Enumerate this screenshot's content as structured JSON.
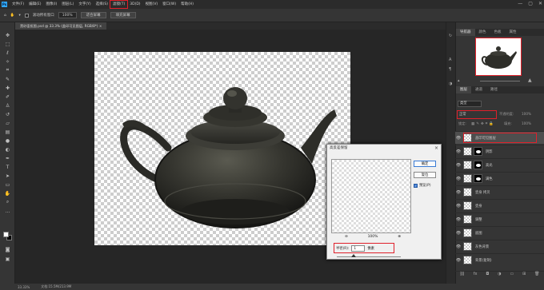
{
  "menubar": {
    "logo": "Ps",
    "items": [
      "文件(F)",
      "编辑(E)",
      "图像(I)",
      "图层(L)",
      "文字(Y)",
      "选择(S)",
      "滤镜(T)",
      "3D(D)",
      "视图(V)",
      "窗口(W)",
      "帮助(H)"
    ],
    "highlighted_index": 6,
    "window_controls": [
      "—",
      "▢",
      "✕"
    ]
  },
  "options": {
    "scroll_all_windows": "滚动所有窗口",
    "zoom": "100%",
    "fit_screen": "适合屏幕",
    "fill_screen": "填充屏幕"
  },
  "document": {
    "tab": "黑砂壶抠图.psd @ 33.3% (盖印可见图层, RGB/8*) ×"
  },
  "status": {
    "zoom": "33.33%",
    "doc": "文档:15.5M/213.9M"
  },
  "dialog": {
    "title": "高反差保留",
    "close": "×",
    "ok": "确定",
    "reset": "复位",
    "preview_label": "预览(P)",
    "zoom_out": "⊖",
    "zoom_level": "100%",
    "zoom_in": "⊕",
    "radius_label": "半径(R):",
    "radius_value": "1",
    "radius_unit": "像素"
  },
  "navigator": {
    "tabs": [
      "导航器",
      "颜色",
      "色板",
      "属性"
    ],
    "active": 0
  },
  "layers_panel": {
    "tabs": [
      "图层",
      "通道",
      "路径"
    ],
    "active": 0,
    "kind": "类型",
    "blend_mode": "正常",
    "opacity_label": "不透明度:",
    "opacity_value": "100%",
    "lock_label": "锁定:",
    "fill_label": "填充:",
    "fill_value": "100%",
    "layers": [
      {
        "name": "盖印可见图层",
        "highlighted": true,
        "mask": false
      },
      {
        "name": "阴影",
        "highlighted": false,
        "mask": true
      },
      {
        "name": "高光",
        "highlighted": false,
        "mask": true
      },
      {
        "name": "满色",
        "highlighted": false,
        "mask": true
      },
      {
        "name": "壶身 拷贝",
        "highlighted": false,
        "mask": false
      },
      {
        "name": "壶身",
        "highlighted": false,
        "mask": false
      },
      {
        "name": "调整",
        "highlighted": false,
        "mask": false
      },
      {
        "name": "底图",
        "highlighted": false,
        "mask": false
      },
      {
        "name": "灰色背景",
        "highlighted": false,
        "mask": false
      },
      {
        "name": "背景(复制)",
        "highlighted": false,
        "mask": false
      }
    ]
  },
  "icons": [
    "move-icon",
    "marquee-icon",
    "lasso-icon",
    "magic-wand-icon",
    "crop-icon",
    "eyedropper-icon",
    "healing-brush-icon",
    "brush-icon",
    "stamp-icon",
    "history-brush-icon",
    "eraser-icon",
    "gradient-icon",
    "blur-icon",
    "dodge-icon",
    "pen-icon",
    "type-icon",
    "path-select-icon",
    "shape-icon",
    "hand-icon",
    "zoom-icon"
  ]
}
